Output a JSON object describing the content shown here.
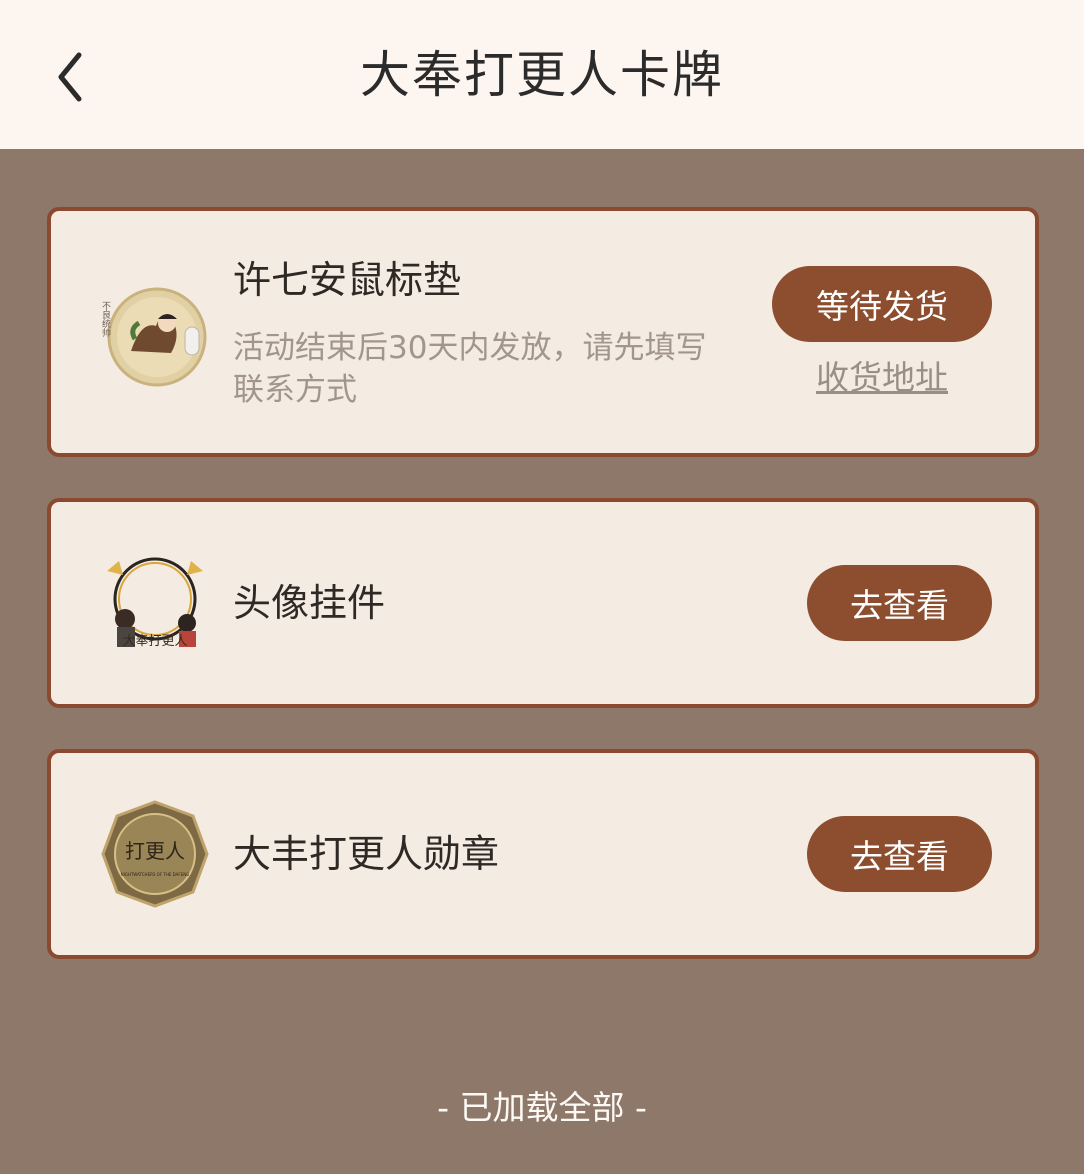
{
  "header": {
    "title": "大奉打更人卡牌",
    "back_icon": "chevron-left-icon"
  },
  "items": [
    {
      "title": "许七安鼠标垫",
      "description": "活动结束后30天内发放，请先填写联系方式",
      "button_label": "等待发货",
      "link_label": "收货地址",
      "thumb_icon": "mousepad-thumbnail",
      "thumb_text": "不良统帅"
    },
    {
      "title": "头像挂件",
      "button_label": "去查看",
      "thumb_icon": "avatar-frame-thumbnail",
      "thumb_text": "大奉打更人"
    },
    {
      "title": "大丰打更人勋章",
      "button_label": "去查看",
      "thumb_icon": "medal-thumbnail",
      "thumb_text": "打更人",
      "thumb_subtext": "NIGHTWATCHERS OF THE DAFENG"
    }
  ],
  "footer": {
    "status_text": "- 已加载全部 -"
  },
  "colors": {
    "background": "#8d786a",
    "header_bg": "#fdf5f0",
    "card_bg": "#f4ebe3",
    "card_border": "#8b4a2f",
    "button_bg": "#8c4e2e"
  }
}
